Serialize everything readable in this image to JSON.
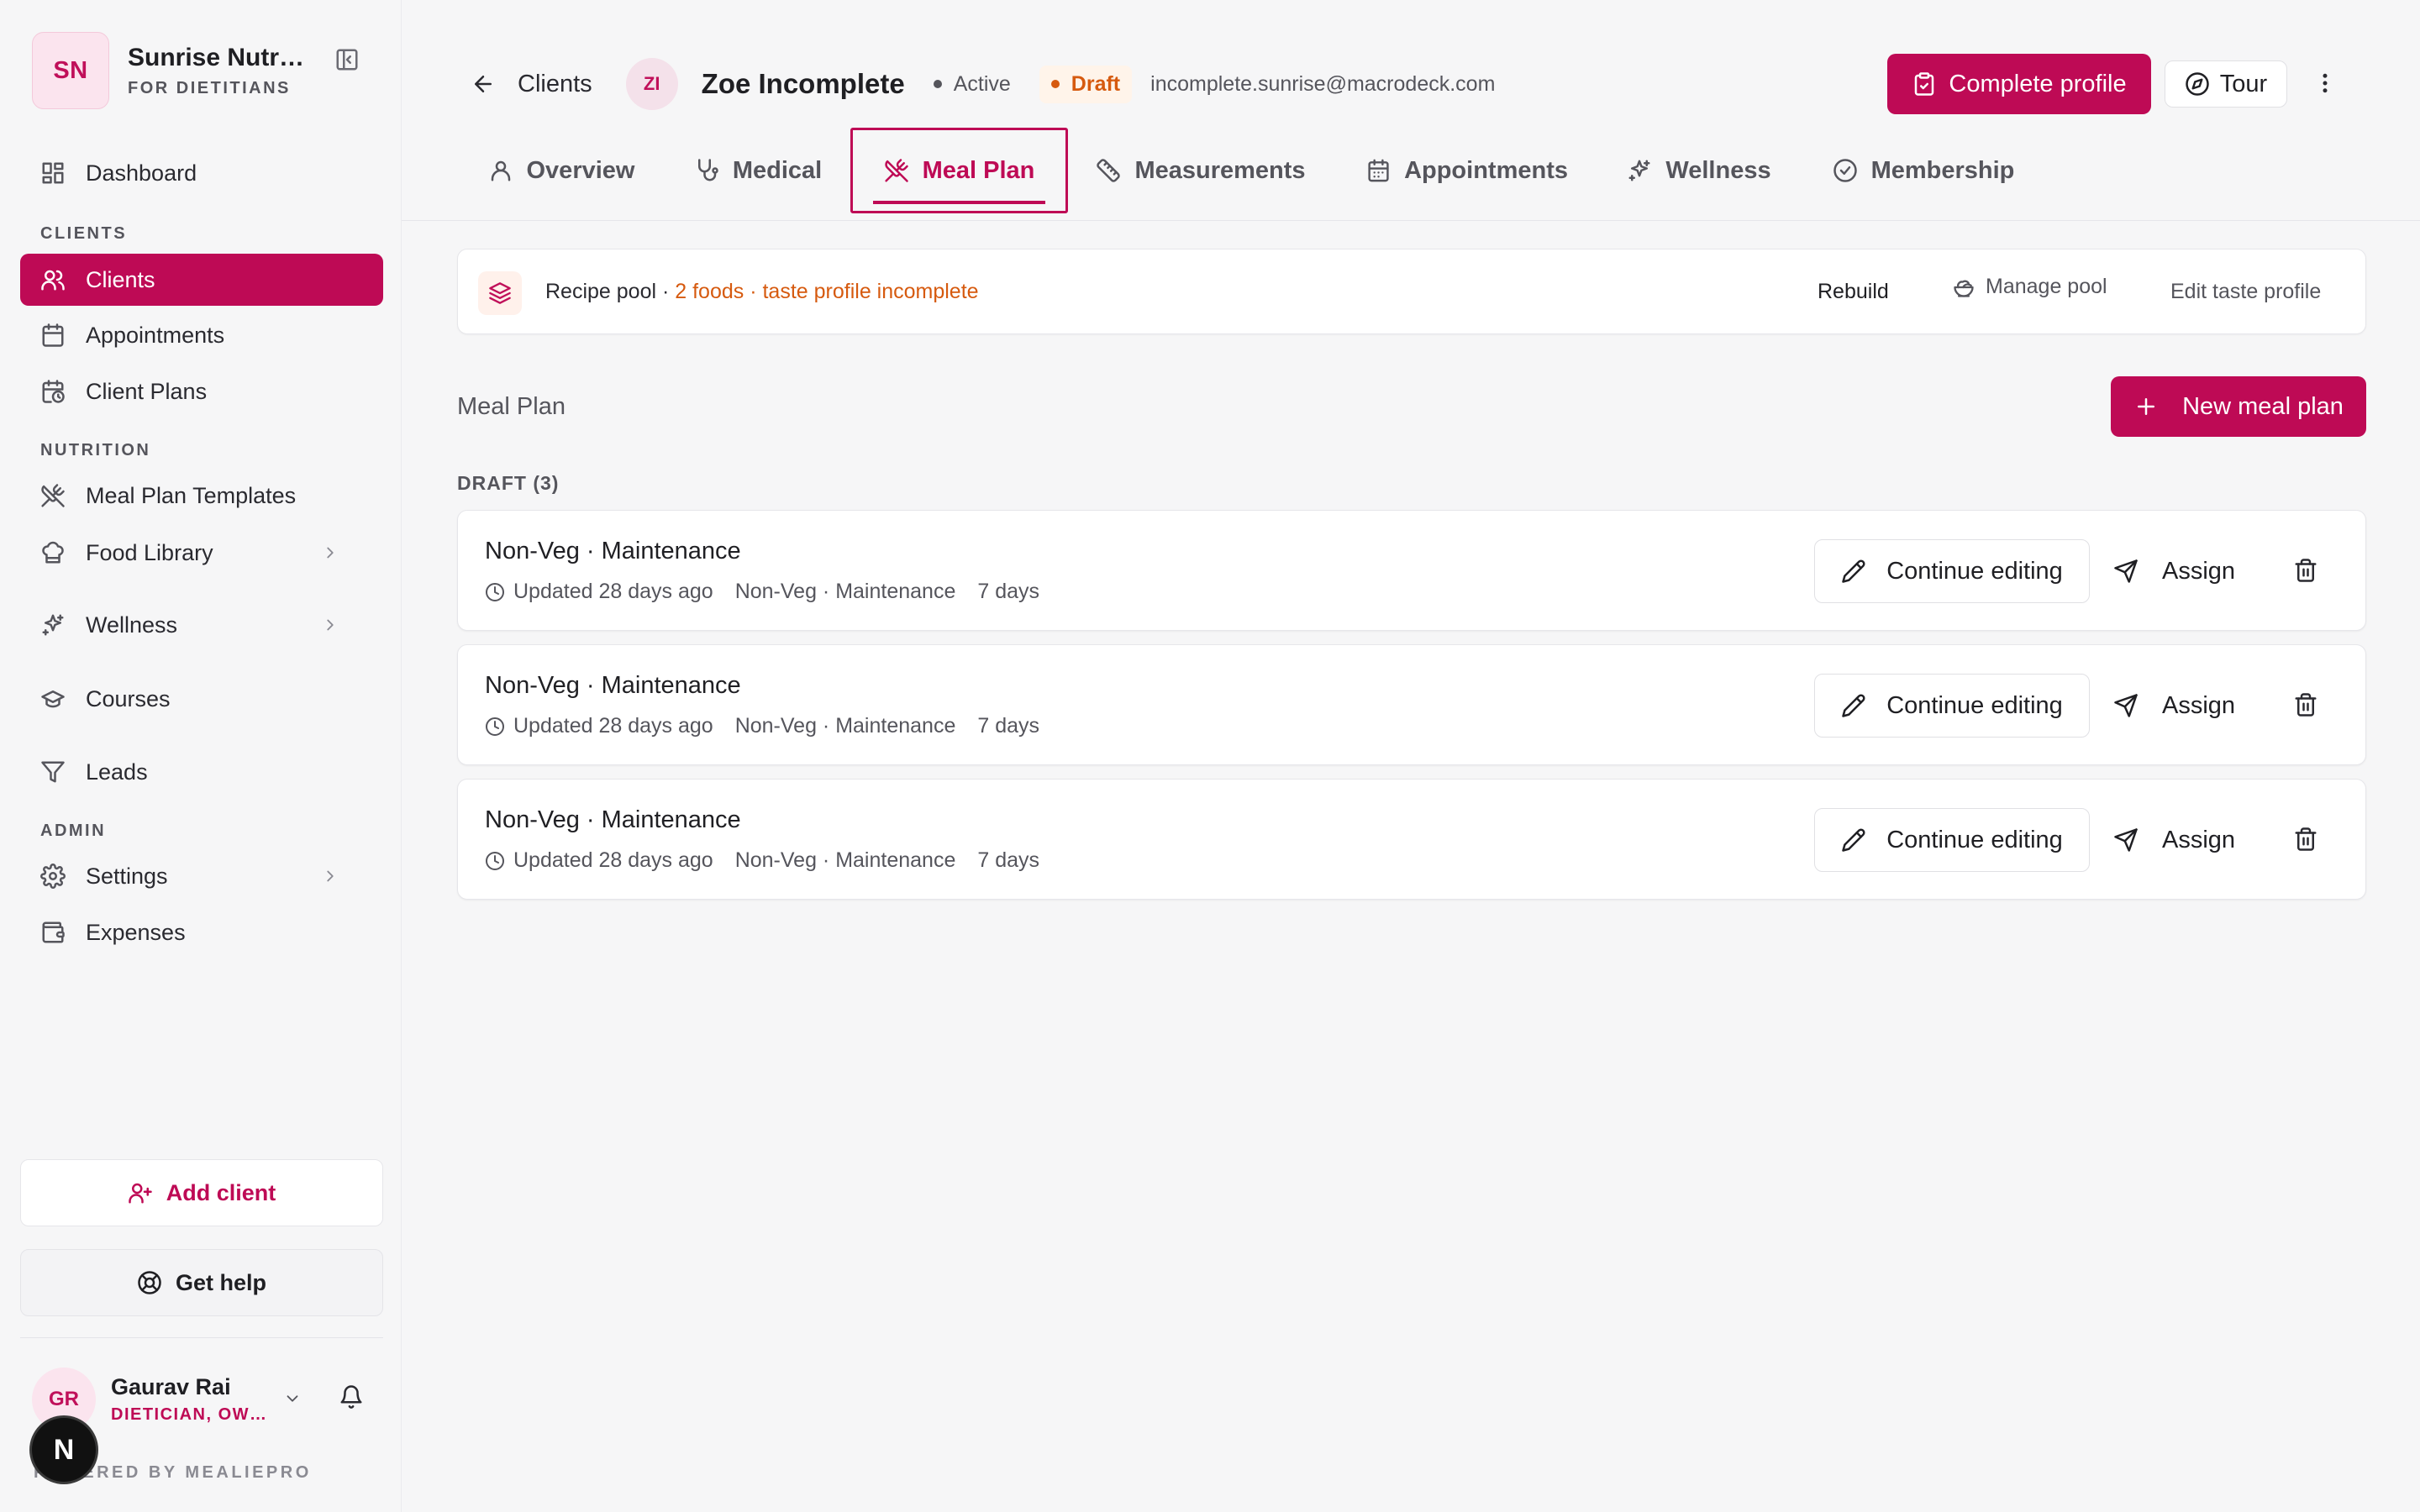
{
  "brand": {
    "initials": "SN",
    "name": "Sunrise Nutrition",
    "subtitle": "FOR DIETITIANS"
  },
  "nav": {
    "sections": {
      "clients": "CLIENTS",
      "nutrition": "NUTRITION",
      "admin": "ADMIN"
    },
    "items": [
      {
        "label": "Dashboard",
        "icon": "dashboard-icon"
      },
      {
        "label": "Clients",
        "icon": "users-icon",
        "active": true
      },
      {
        "label": "Appointments",
        "icon": "calendar-icon"
      },
      {
        "label": "Client Plans",
        "icon": "calendar-clock-icon"
      },
      {
        "label": "Meal Plan Templates",
        "icon": "utensils-crossed-icon"
      },
      {
        "label": "Food Library",
        "icon": "chef-hat-icon"
      },
      {
        "label": "Wellness",
        "icon": "sparkles-icon"
      },
      {
        "label": "Courses",
        "icon": "graduation-cap-icon"
      },
      {
        "label": "Leads",
        "icon": "funnel-icon"
      },
      {
        "label": "Settings",
        "icon": "gear-icon"
      },
      {
        "label": "Expenses",
        "icon": "wallet-icon"
      }
    ]
  },
  "sidebar_actions": {
    "add_client": "Add client",
    "get_help": "Get help"
  },
  "user": {
    "initials": "GR",
    "name": "Gaurav Rai",
    "role": "DIETICIAN, OWNER"
  },
  "powered_by": "POWERED BY MEALIEPRO",
  "next_badge": "N",
  "header": {
    "back_label": "Clients",
    "client_initials": "ZI",
    "client_name": "Zoe Incomplete",
    "status": "Active",
    "status_color": "#55555c",
    "draft": "Draft",
    "draft_color": "#d65a0f",
    "email": "incomplete.sunrise@macrodeck.com",
    "complete_profile": "Complete profile",
    "tour": "Tour"
  },
  "tabs": [
    {
      "label": "Overview",
      "icon": "user-icon"
    },
    {
      "label": "Medical",
      "icon": "stethoscope-icon"
    },
    {
      "label": "Meal Plan",
      "icon": "utensils-crossed-icon",
      "active": true
    },
    {
      "label": "Measurements",
      "icon": "ruler-icon"
    },
    {
      "label": "Appointments",
      "icon": "calendar-icon"
    },
    {
      "label": "Wellness",
      "icon": "sparkles-icon"
    },
    {
      "label": "Membership",
      "icon": "badge-check-icon"
    }
  ],
  "recipe_pool": {
    "label": "Recipe pool",
    "sep": " · ",
    "foods": "2 foods",
    "warning": "taste profile incomplete",
    "rebuild": "Rebuild",
    "manage": "Manage pool",
    "edit": "Edit taste profile"
  },
  "meal_plan": {
    "title": "Meal Plan",
    "new_button": "New meal plan",
    "draft_label": "DRAFT (3)",
    "continue_label": "Continue editing",
    "assign_label": "Assign",
    "plans": [
      {
        "name": "Non-Veg · Maintenance",
        "updated": "Updated 28 days ago",
        "type": "Non-Veg · Maintenance",
        "duration": "7 days"
      },
      {
        "name": "Non-Veg · Maintenance",
        "updated": "Updated 28 days ago",
        "type": "Non-Veg · Maintenance",
        "duration": "7 days"
      },
      {
        "name": "Non-Veg · Maintenance",
        "updated": "Updated 28 days ago",
        "type": "Non-Veg · Maintenance",
        "duration": "7 days"
      }
    ]
  },
  "colors": {
    "accent": "#be0a55",
    "warning": "#d65a0f"
  }
}
